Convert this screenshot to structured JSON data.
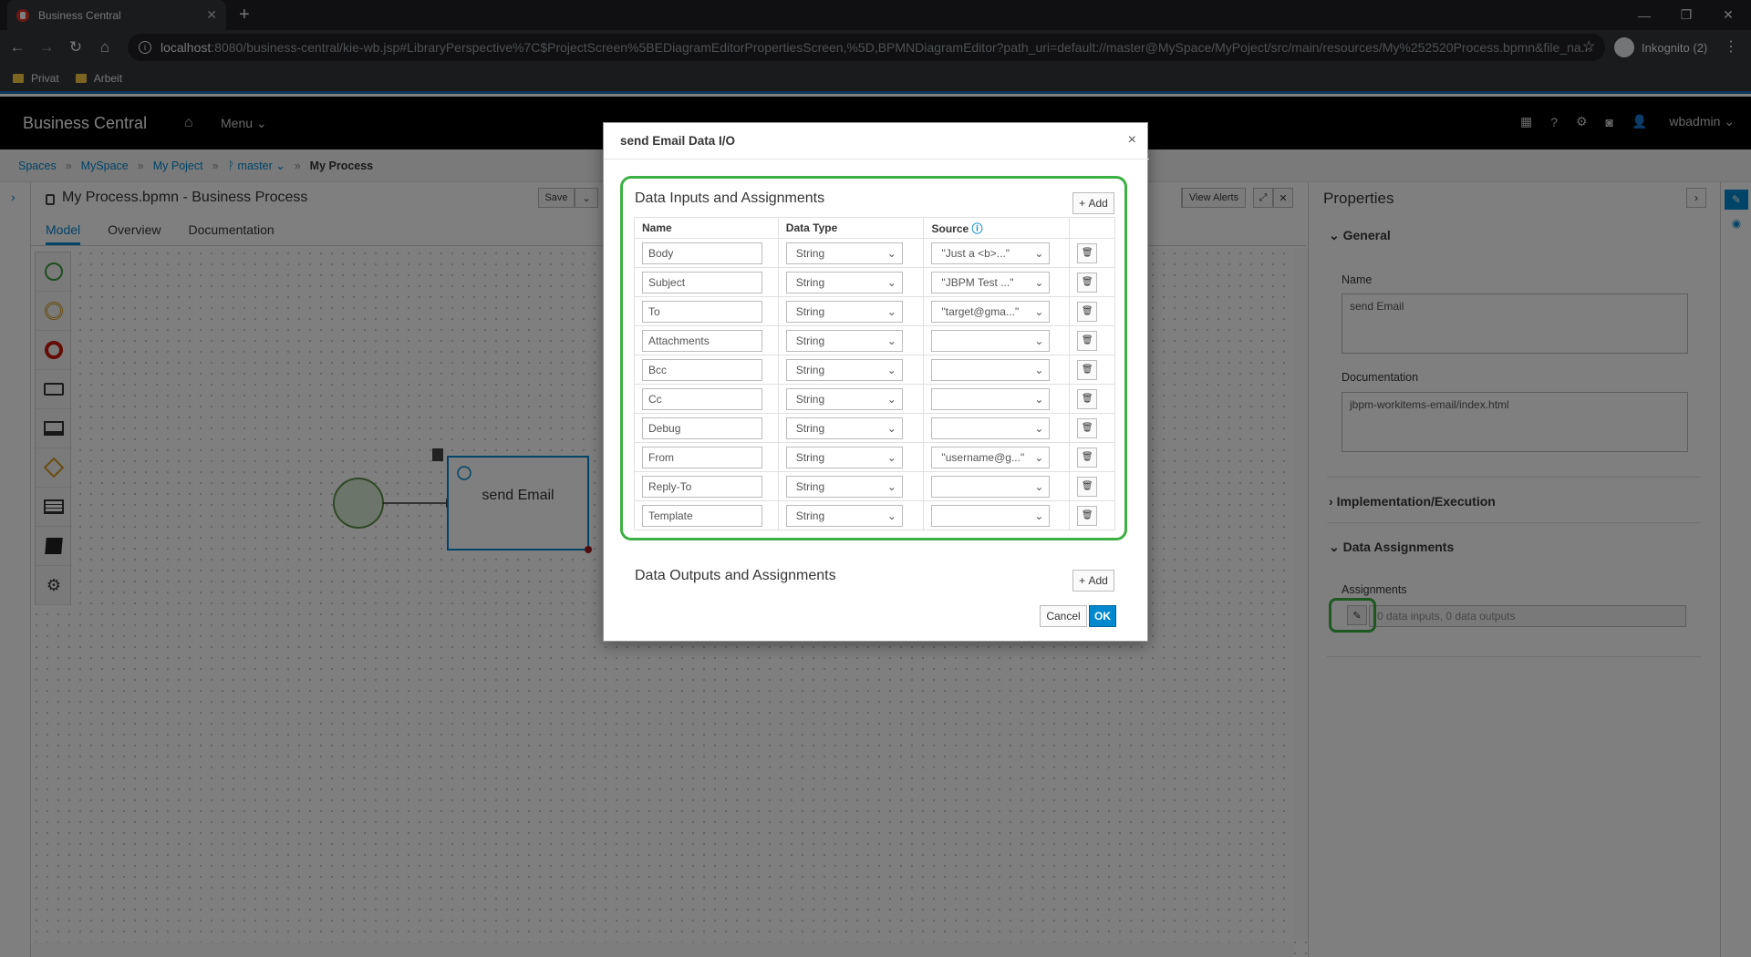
{
  "browser": {
    "tab_title": "Business Central",
    "url_host": "localhost",
    "url_path": ":8080/business-central/kie-wb.jsp#LibraryPerspective%7C$ProjectScreen%5BEDiagramEditorPropertiesScreen,%5D,BPMNDiagramEditor?path_uri=default://master@MySpace/MyPoject/src/main/resources/My%252520Process.bpmn&file_na...",
    "incognito_label": "Inkognito (2)",
    "bookmarks": [
      "Privat",
      "Arbeit"
    ]
  },
  "app": {
    "brand": "Business Central",
    "menu_label": "Menu",
    "user": "wbadmin"
  },
  "breadcrumb": {
    "items": [
      "Spaces",
      "MySpace",
      "My Poject",
      "master"
    ],
    "current": "My Process"
  },
  "editor": {
    "title": "My Process.bpmn - Business Process",
    "save_label": "Save",
    "view_alerts_label": "View Alerts",
    "tabs": [
      "Model",
      "Overview",
      "Documentation"
    ],
    "task_label": "send Email"
  },
  "properties": {
    "title": "Properties",
    "general_label": "General",
    "name_label": "Name",
    "name_value": "send Email",
    "documentation_label": "Documentation",
    "documentation_value": "jbpm-workitems-email/index.html",
    "implementation_label": "Implementation/Execution",
    "data_assignments_label": "Data Assignments",
    "assignments_label": "Assignments",
    "assignments_value": "0 data inputs, 0 data outputs"
  },
  "dialog": {
    "title": "send Email Data I/O",
    "inputs_title": "Data Inputs and Assignments",
    "outputs_title": "Data Outputs and Assignments",
    "add_label": "Add",
    "columns": [
      "Name",
      "Data Type",
      "Source"
    ],
    "rows": [
      {
        "name": "Body",
        "type": "String",
        "source": "\"Just a <b>...\""
      },
      {
        "name": "Subject",
        "type": "String",
        "source": "\"JBPM Test ...\""
      },
      {
        "name": "To",
        "type": "String",
        "source": "\"target@gma...\""
      },
      {
        "name": "Attachments",
        "type": "String",
        "source": ""
      },
      {
        "name": "Bcc",
        "type": "String",
        "source": ""
      },
      {
        "name": "Cc",
        "type": "String",
        "source": ""
      },
      {
        "name": "Debug",
        "type": "String",
        "source": ""
      },
      {
        "name": "From",
        "type": "String",
        "source": "\"username@g...\""
      },
      {
        "name": "Reply-To",
        "type": "String",
        "source": ""
      },
      {
        "name": "Template",
        "type": "String",
        "source": ""
      }
    ],
    "cancel_label": "Cancel",
    "ok_label": "OK"
  },
  "colors": {
    "accent": "#0088ce",
    "highlight": "#3cb043",
    "app_bar": "#000000"
  }
}
